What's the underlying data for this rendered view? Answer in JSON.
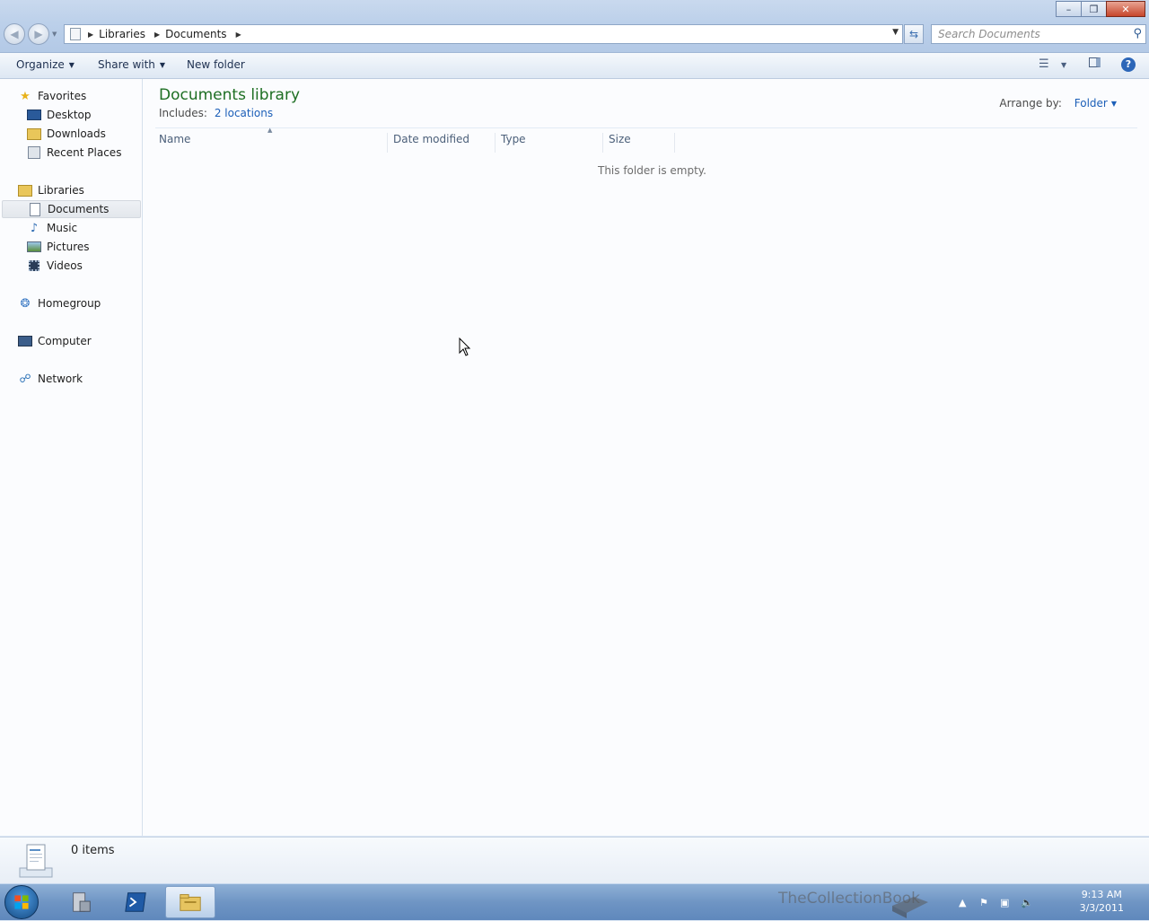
{
  "window": {
    "minimize": "–",
    "restore": "❐",
    "close": "✕"
  },
  "address": {
    "crumbs": [
      "Libraries",
      "Documents"
    ]
  },
  "search": {
    "placeholder": "Search Documents"
  },
  "toolbar": {
    "organize": "Organize",
    "share_with": "Share with",
    "new_folder": "New folder",
    "help": "?"
  },
  "nav": {
    "favorites": {
      "label": "Favorites",
      "items": [
        "Desktop",
        "Downloads",
        "Recent Places"
      ]
    },
    "libraries": {
      "label": "Libraries",
      "items": [
        "Documents",
        "Music",
        "Pictures",
        "Videos"
      ]
    },
    "homegroup": "Homegroup",
    "computer": "Computer",
    "network": "Network",
    "selected": "Documents"
  },
  "content": {
    "title": "Documents library",
    "includes_label": "Includes:",
    "includes_link": "2 locations",
    "arrange_label": "Arrange by:",
    "arrange_value": "Folder",
    "columns": [
      "Name",
      "Date modified",
      "Type",
      "Size"
    ],
    "empty_message": "This folder is empty."
  },
  "details": {
    "item_count": "0 items"
  },
  "taskbar": {
    "time": "9:13 AM",
    "date": "3/3/2011",
    "watermark": "TheCollectionBook"
  },
  "colors": {
    "title_green": "#1e6f23",
    "link_blue": "#1c5fb8",
    "close_red": "#c7462b"
  }
}
